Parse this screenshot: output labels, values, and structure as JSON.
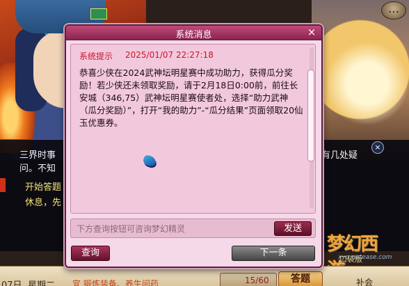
{
  "top_button": {
    "label": "…"
  },
  "info_panel": {
    "line1_left": "三界时事",
    "line1_right": "有几处疑",
    "line2_left": "问。不知",
    "line3": "开始答题",
    "line4": "休息，先"
  },
  "dialog": {
    "title": "系统消息",
    "close_label": "×",
    "heading": "系统提示",
    "timestamp": "2025/01/07 22:27:18",
    "message": "恭喜少侠在2024武神坛明星赛中成功助力，获得瓜分奖励！若少侠还未领取奖励，请于2月18日0:00前，前往长安城（346,75）武神坛明星赛使者处，选择“助力武神（瓜分奖励）”，打开“我的助力”-“瓜分结果”页面领取20仙玉优惠券。",
    "input_placeholder": "下方查询按钮可咨询梦幻精灵",
    "send_label": "发送",
    "query_label": "查询",
    "next_label": "下一条"
  },
  "bottom_bar": {
    "date_fragment": "07日",
    "weekday": "星期二",
    "quest": "宜 锻炼装备、养生问药",
    "count": "15/60",
    "answer_label": "答题",
    "right_label": "补会"
  },
  "logo": {
    "main": "梦幻西游",
    "sub": "口袋版",
    "url": "xyq.netease.com"
  },
  "colors": {
    "titlebar": "#a83562",
    "body_bg": "#f2c9dc",
    "heading_red": "#d0102a",
    "send_bg": "#7a1e3c"
  }
}
